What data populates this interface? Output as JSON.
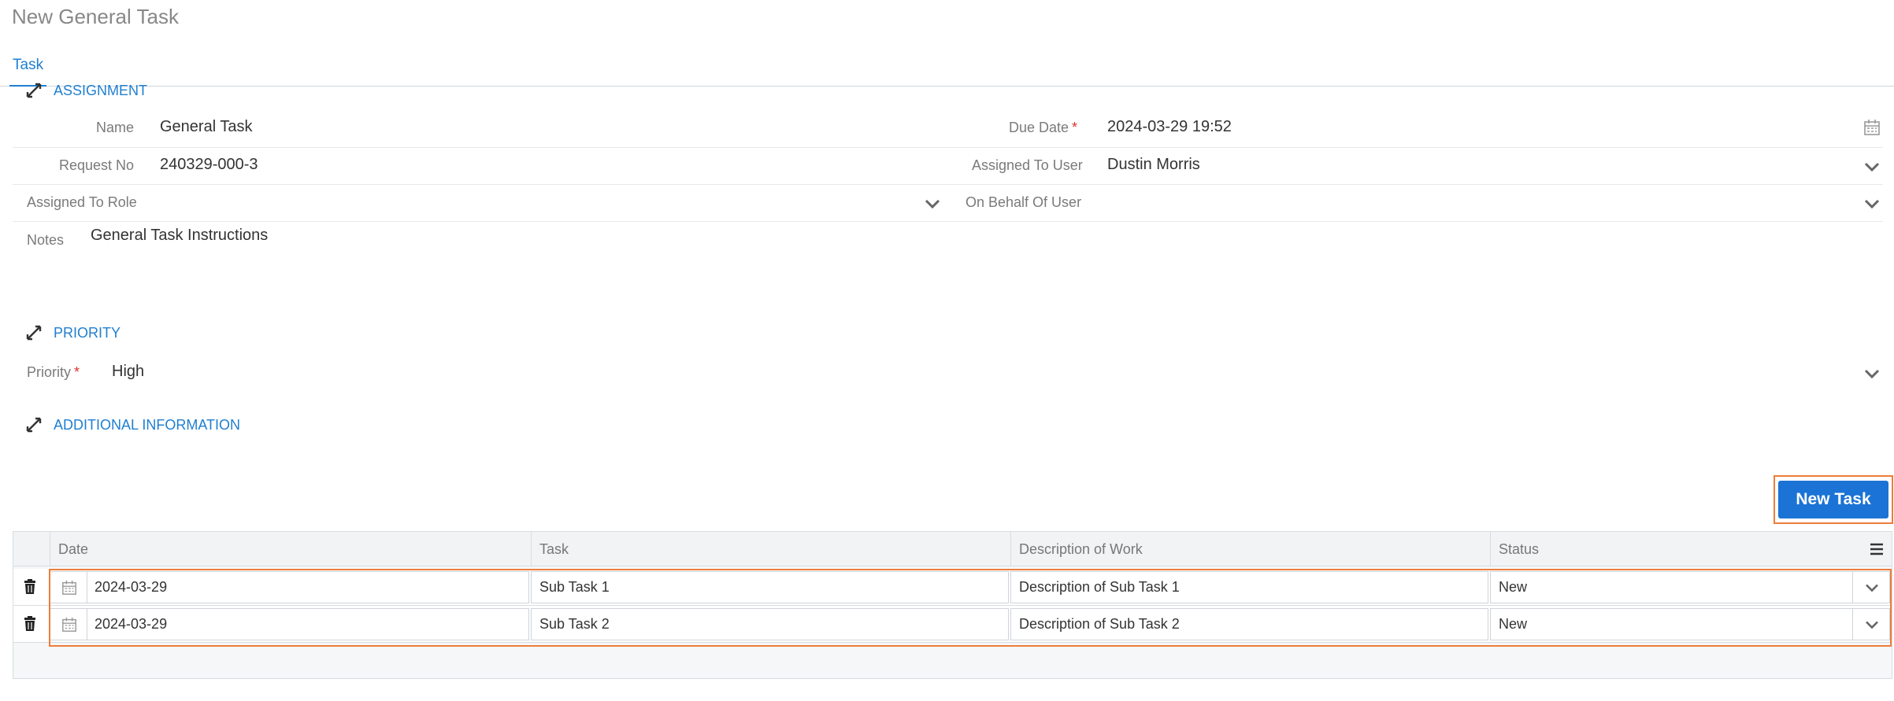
{
  "page": {
    "title": "New General Task"
  },
  "tabs": [
    {
      "label": "Task"
    }
  ],
  "assignment": {
    "section_label": "ASSIGNMENT",
    "name_label": "Name",
    "name_value": "General Task",
    "due_date_label": "Due Date",
    "due_date_value": "2024-03-29 19:52",
    "request_no_label": "Request No",
    "request_no_value": "240329-000-3",
    "assigned_to_user_label": "Assigned To User",
    "assigned_to_user_value": "Dustin Morris",
    "assigned_to_role_label": "Assigned To Role",
    "assigned_to_role_value": "",
    "on_behalf_of_user_label": "On Behalf Of User",
    "on_behalf_of_user_value": "",
    "notes_label": "Notes",
    "notes_value": "General Task Instructions"
  },
  "priority": {
    "section_label": "PRIORITY",
    "priority_label": "Priority",
    "priority_value": "High"
  },
  "additional": {
    "section_label": "ADDITIONAL INFORMATION"
  },
  "subtasks": {
    "new_task_label": "New Task",
    "columns": [
      "Date",
      "Task",
      "Description of Work",
      "Status"
    ],
    "rows": [
      {
        "date": "2024-03-29",
        "task": "Sub Task 1",
        "description": "Description of Sub Task 1",
        "status": "New"
      },
      {
        "date": "2024-03-29",
        "task": "Sub Task 2",
        "description": "Description of Sub Task 2",
        "status": "New"
      }
    ]
  },
  "icons": {
    "collapse": "collapse-arrows-icon",
    "calendar": "calendar-icon",
    "dropdown": "chevron-down-icon",
    "delete": "trash-icon",
    "grid_menu": "hamburger-menu-icon"
  },
  "colors": {
    "accent": "#1f7fd0",
    "button": "#1b73d5",
    "highlight": "#ee7d3b",
    "required": "#d9342b"
  }
}
